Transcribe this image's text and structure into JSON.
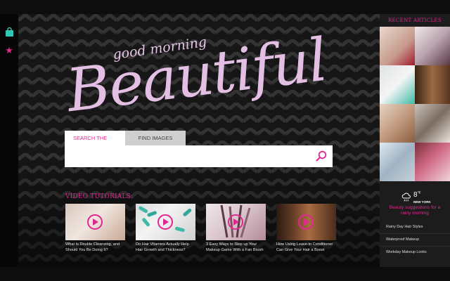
{
  "left_bar": {
    "icons": [
      {
        "name": "shopping-bag-icon",
        "glyph": "🛍",
        "color": "#2fc6b4"
      },
      {
        "name": "star-icon",
        "glyph": "★",
        "color": "#e0288f"
      }
    ]
  },
  "logo": {
    "small": "good morning",
    "big": "Beautiful"
  },
  "search": {
    "tabs": [
      "SEARCH THE WEB",
      "FIND IMAGES"
    ],
    "active_tab": "SEARCH THE WEB",
    "placeholder": "",
    "value": ""
  },
  "videos": {
    "title": "VIDEO TUTORIALS:",
    "items": [
      {
        "caption": "What Is Double Cleansing, and Should You Be Doing It?"
      },
      {
        "caption": "Do Hair Vitamins Actually Help Hair Growth and Thickness?"
      },
      {
        "caption": "3 Easy Ways to Step up Your Makeup Game With a Fan Brush"
      },
      {
        "caption": "How Using Leave-in Conditioner Can Give Your Hair a Boost"
      }
    ]
  },
  "sidebar": {
    "title": "RECENT ARTICLES",
    "weather": {
      "temp": "8",
      "unit": "°F",
      "city": "NEW YORK",
      "text": "Beauty suggestions for a rainy morning"
    },
    "links": [
      "Rainy Day Hair Styles",
      "Waterproof Makeup",
      "Workday Makeup Looks"
    ]
  },
  "colors": {
    "accent": "#e0288f",
    "logo": "#e3bfe3"
  }
}
